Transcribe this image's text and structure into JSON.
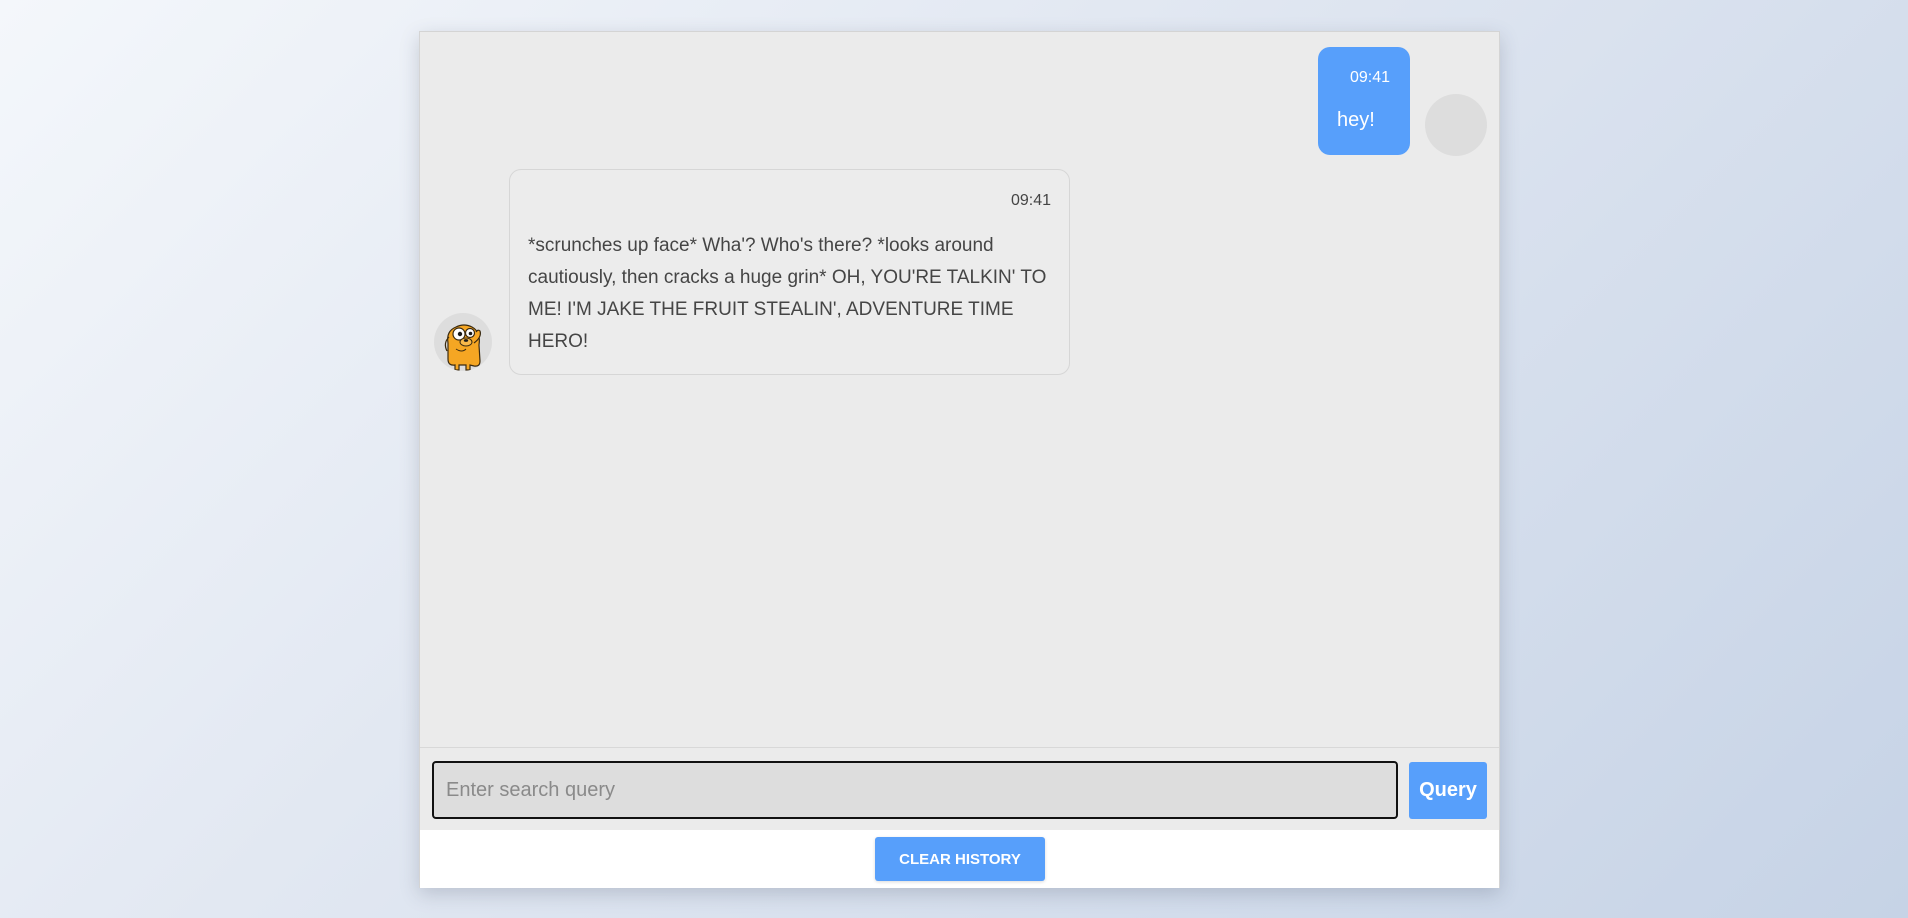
{
  "chat": {
    "messages": [
      {
        "sender": "user",
        "time": "09:41",
        "text": "hey!"
      },
      {
        "sender": "bot",
        "time": "09:41",
        "text": "*scrunches up face* Wha'? Who's there? *looks around cautiously, then cracks a huge grin* OH, YOU'RE TALKIN' TO ME! I'M JAKE THE FRUIT STEALIN', ADVENTURE TIME HERO!"
      }
    ]
  },
  "input": {
    "placeholder": "Enter search query",
    "value": ""
  },
  "buttons": {
    "query_label": "Query",
    "clear_label": "CLEAR HISTORY"
  },
  "colors": {
    "accent": "#579ffb",
    "chat_background": "#ebebeb",
    "avatar_placeholder": "#dddddd"
  },
  "icons": {
    "bot_avatar": "jake-dog-avatar",
    "user_avatar": "user-avatar-placeholder"
  }
}
